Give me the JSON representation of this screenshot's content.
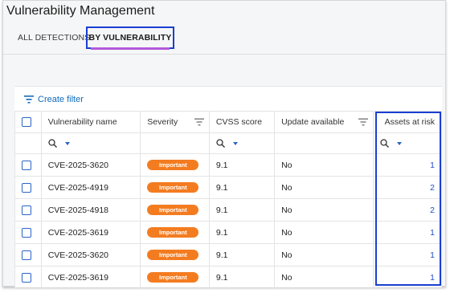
{
  "app": {
    "title": "Vulnerability Management"
  },
  "tabs": [
    {
      "label": "ALL DETECTIONS",
      "active": false
    },
    {
      "label": "BY VULNERABILITY",
      "active": true
    }
  ],
  "toolbar": {
    "create_filter_label": "Create filter"
  },
  "table": {
    "columns": [
      "Vulnerability name",
      "Severity",
      "CVSS score",
      "Update available",
      "Assets at risk"
    ],
    "rows": [
      {
        "name": "CVE-2025-3620",
        "severity": "Important",
        "cvss": "9.1",
        "update": "No",
        "assets": "1"
      },
      {
        "name": "CVE-2025-4919",
        "severity": "Important",
        "cvss": "9.1",
        "update": "No",
        "assets": "2"
      },
      {
        "name": "CVE-2025-4918",
        "severity": "Important",
        "cvss": "9.1",
        "update": "No",
        "assets": "2"
      },
      {
        "name": "CVE-2025-3619",
        "severity": "Important",
        "cvss": "9.1",
        "update": "No",
        "assets": "1"
      },
      {
        "name": "CVE-2025-3620",
        "severity": "Important",
        "cvss": "9.1",
        "update": "No",
        "assets": "1"
      },
      {
        "name": "CVE-2025-3619",
        "severity": "Important",
        "cvss": "9.1",
        "update": "No",
        "assets": "1"
      }
    ]
  },
  "colors": {
    "accent": "#0f6cbd",
    "severity_important": "#f47c20",
    "highlight": "#1a3fd1",
    "tab_underline": "#b35ad8"
  }
}
